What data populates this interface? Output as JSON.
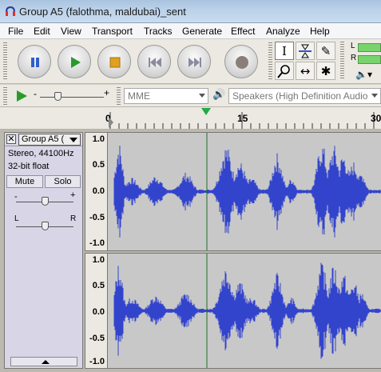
{
  "window": {
    "title": "Group A5 (falothma, maldubai)_sent",
    "icon": "audacity-headphones-icon"
  },
  "menu": [
    "File",
    "Edit",
    "View",
    "Transport",
    "Tracks",
    "Generate",
    "Effect",
    "Analyze",
    "Help"
  ],
  "transport": {
    "buttons": [
      {
        "name": "pause",
        "icon": "pause-icon"
      },
      {
        "name": "play",
        "icon": "play-icon"
      },
      {
        "name": "stop",
        "icon": "stop-icon"
      },
      {
        "name": "skip-start",
        "icon": "skip-to-start-icon"
      },
      {
        "name": "skip-end",
        "icon": "skip-to-end-icon"
      },
      {
        "name": "record",
        "icon": "record-icon"
      }
    ],
    "colors": {
      "pause": "#2f5fc9",
      "play": "#2a9a2a",
      "stop": "#e0a020",
      "skip": "#8a8aa0",
      "record": "#8a7f78"
    }
  },
  "tools": [
    {
      "name": "selection-tool",
      "glyph": "I"
    },
    {
      "name": "envelope-tool",
      "glyph": "≈"
    },
    {
      "name": "draw-tool",
      "glyph": "✎"
    },
    {
      "name": "zoom-tool",
      "glyph": "⚲"
    },
    {
      "name": "timeshift-tool",
      "glyph": "↔"
    },
    {
      "name": "multi-tool",
      "glyph": "✱"
    }
  ],
  "meters": {
    "left_label": "L",
    "right_label": "R"
  },
  "devices": {
    "host": "MME",
    "output": "Speakers (High Definition Audio"
  },
  "ruler": {
    "ticks": [
      "0",
      "15",
      "30"
    ]
  },
  "track": {
    "name": "Group A5 (",
    "info_line1": "Stereo, 44100Hz",
    "info_line2": "32-bit float",
    "mute": "Mute",
    "solo": "Solo",
    "pan_left": "L",
    "pan_right": "R",
    "gain_minus": "-",
    "gain_plus": "+",
    "wave_color": "#3344cc",
    "scale_labels": [
      "1.0",
      "0.5",
      "0.0",
      "-0.5",
      "-1.0"
    ]
  }
}
